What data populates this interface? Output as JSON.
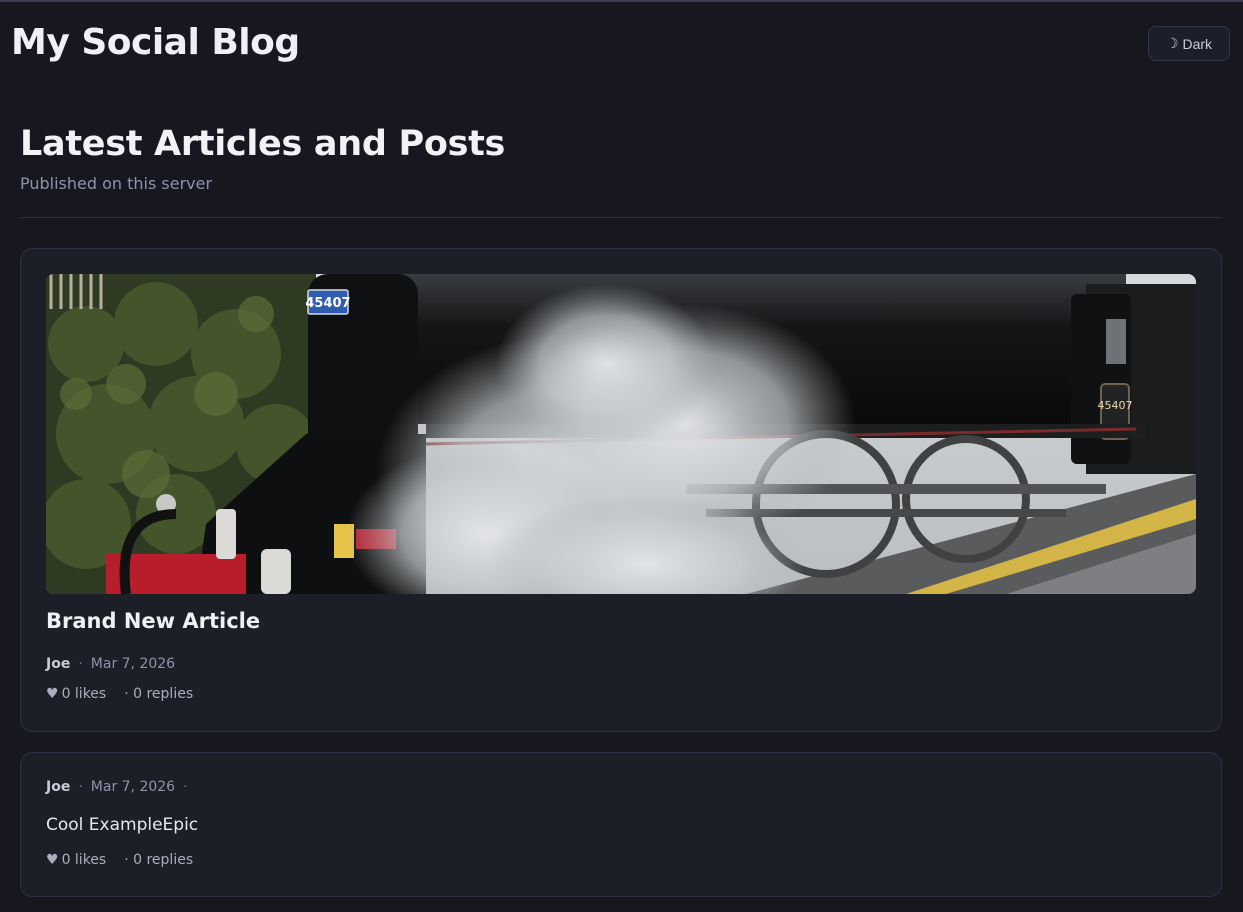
{
  "header": {
    "site_title": "My Social Blog",
    "theme_toggle": {
      "icon": "moon-icon",
      "glyph": "☽",
      "label": "Dark"
    }
  },
  "page": {
    "title": "Latest Articles and Posts",
    "subtitle": "Published on this server"
  },
  "posts": [
    {
      "type": "article",
      "title": "Brand New Article",
      "author": "Joe",
      "date": "Mar 7, 2026",
      "image": {
        "icon": "steam-locomotive-image",
        "number_plate": "45407"
      },
      "likes": "0 likes",
      "replies": "· 0 replies"
    },
    {
      "type": "note",
      "author": "Joe",
      "date": "Mar 7, 2026",
      "body": "Cool ExampleEpic",
      "likes": "0 likes",
      "replies": "· 0 replies"
    }
  ],
  "colors": {
    "background": "#16171f",
    "card": "#1c1e28",
    "text": "#eef0f5",
    "muted": "#8e93a8"
  }
}
